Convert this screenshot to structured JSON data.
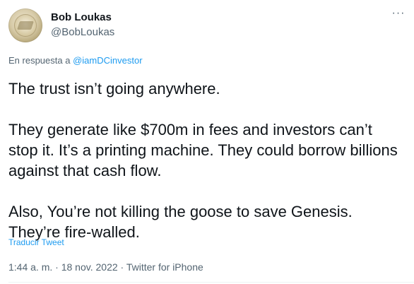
{
  "author": {
    "name": "Bob Loukas",
    "handle": "@BobLoukas"
  },
  "more_icon": "more-horizontal-icon",
  "more_glyph": "···",
  "reply": {
    "prefix": "En respuesta a",
    "target": "@iamDCinvestor"
  },
  "tweet": {
    "paragraphs": [
      "The trust isn’t going anywhere.",
      "They generate like $700m in fees and investors can’t stop it.  It’s a printing machine. They could borrow billions against that cash flow.",
      "Also, You’re not killing the goose to save Genesis. They’re fire-walled."
    ],
    "translate_label": "Traducir Tweet"
  },
  "meta": {
    "time": "1:44 a. m.",
    "separator": "·",
    "date": "18 nov. 2022",
    "source": "Twitter for iPhone"
  },
  "colors": {
    "text": "#0f1419",
    "secondary": "#536471",
    "link": "#1d9bf0"
  }
}
